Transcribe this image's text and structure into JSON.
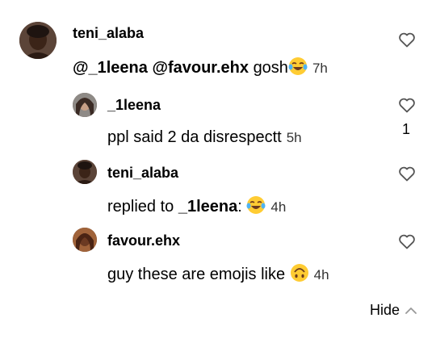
{
  "comment": {
    "username": "teni_alaba",
    "mention1": "@_1leena",
    "mention2": "@favour.ehx",
    "text": "gosh",
    "time": "7h"
  },
  "replies": [
    {
      "username": "_1leena",
      "text": "ppl said 2 da disrespectt",
      "time": "5h",
      "likes": "1"
    },
    {
      "username": "teni_alaba",
      "prefix": "replied to ",
      "mention": "_1leena",
      "suffix": ":",
      "time": "4h"
    },
    {
      "username": "favour.ehx",
      "text": "guy these are emojis like",
      "time": "4h"
    }
  ],
  "hide_label": "Hide",
  "icons": {
    "like": "heart-outline-icon",
    "laugh": "tears-of-joy-emoji",
    "upside_down": "upside-down-face-emoji",
    "collapse": "chevron-up-icon"
  }
}
